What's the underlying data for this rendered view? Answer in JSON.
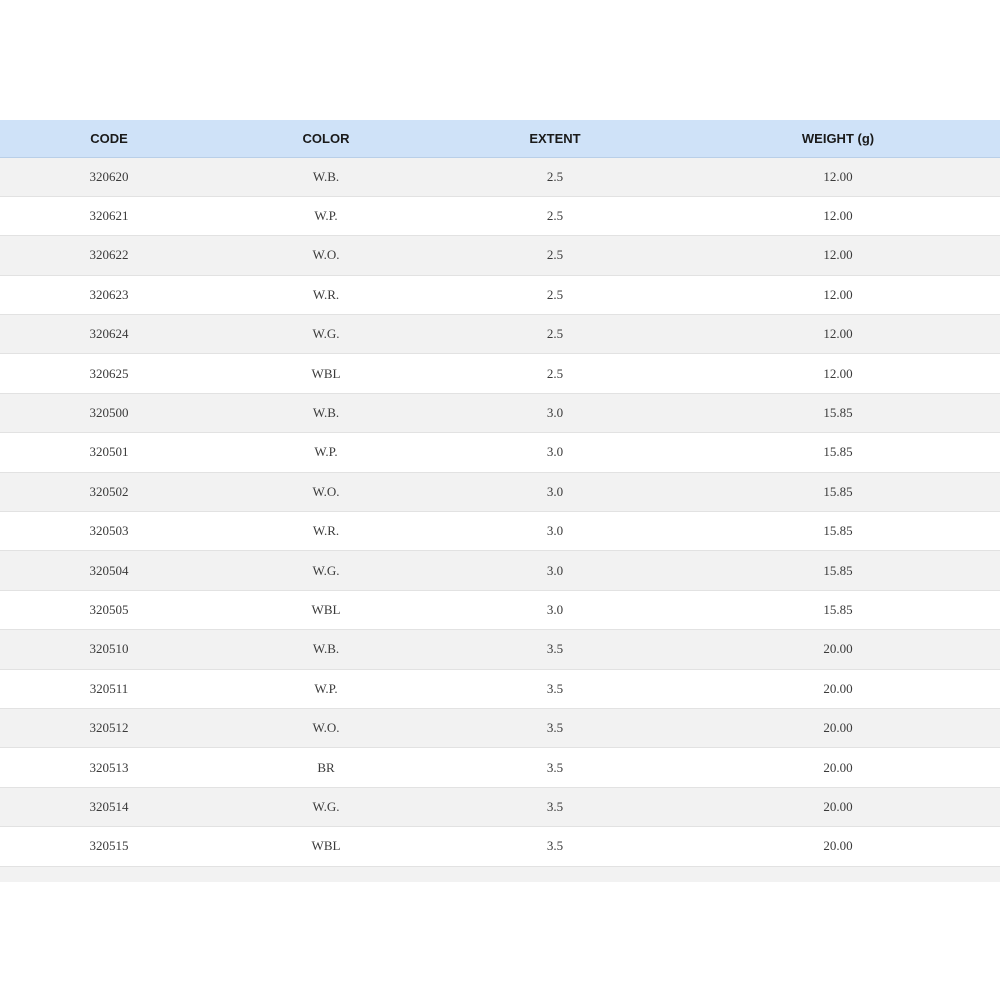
{
  "table": {
    "headers": [
      "CODE",
      "COLOR",
      "EXTENT",
      "WEIGHT (g)"
    ],
    "rows": [
      [
        "320620",
        "W.B.",
        "2.5",
        "12.00"
      ],
      [
        "320621",
        "W.P.",
        "2.5",
        "12.00"
      ],
      [
        "320622",
        "W.O.",
        "2.5",
        "12.00"
      ],
      [
        "320623",
        "W.R.",
        "2.5",
        "12.00"
      ],
      [
        "320624",
        "W.G.",
        "2.5",
        "12.00"
      ],
      [
        "320625",
        "WBL",
        "2.5",
        "12.00"
      ],
      [
        "320500",
        "W.B.",
        "3.0",
        "15.85"
      ],
      [
        "320501",
        "W.P.",
        "3.0",
        "15.85"
      ],
      [
        "320502",
        "W.O.",
        "3.0",
        "15.85"
      ],
      [
        "320503",
        "W.R.",
        "3.0",
        "15.85"
      ],
      [
        "320504",
        "W.G.",
        "3.0",
        "15.85"
      ],
      [
        "320505",
        "WBL",
        "3.0",
        "15.85"
      ],
      [
        "320510",
        "W.B.",
        "3.5",
        "20.00"
      ],
      [
        "320511",
        "W.P.",
        "3.5",
        "20.00"
      ],
      [
        "320512",
        "W.O.",
        "3.5",
        "20.00"
      ],
      [
        "320513",
        "BR",
        "3.5",
        "20.00"
      ],
      [
        "320514",
        "W.G.",
        "3.5",
        "20.00"
      ],
      [
        "320515",
        "WBL",
        "3.5",
        "20.00"
      ]
    ]
  },
  "colors": {
    "header_bg": "#cfe2f8",
    "row_stripe": "#f2f2f2",
    "row_plain": "#ffffff"
  }
}
